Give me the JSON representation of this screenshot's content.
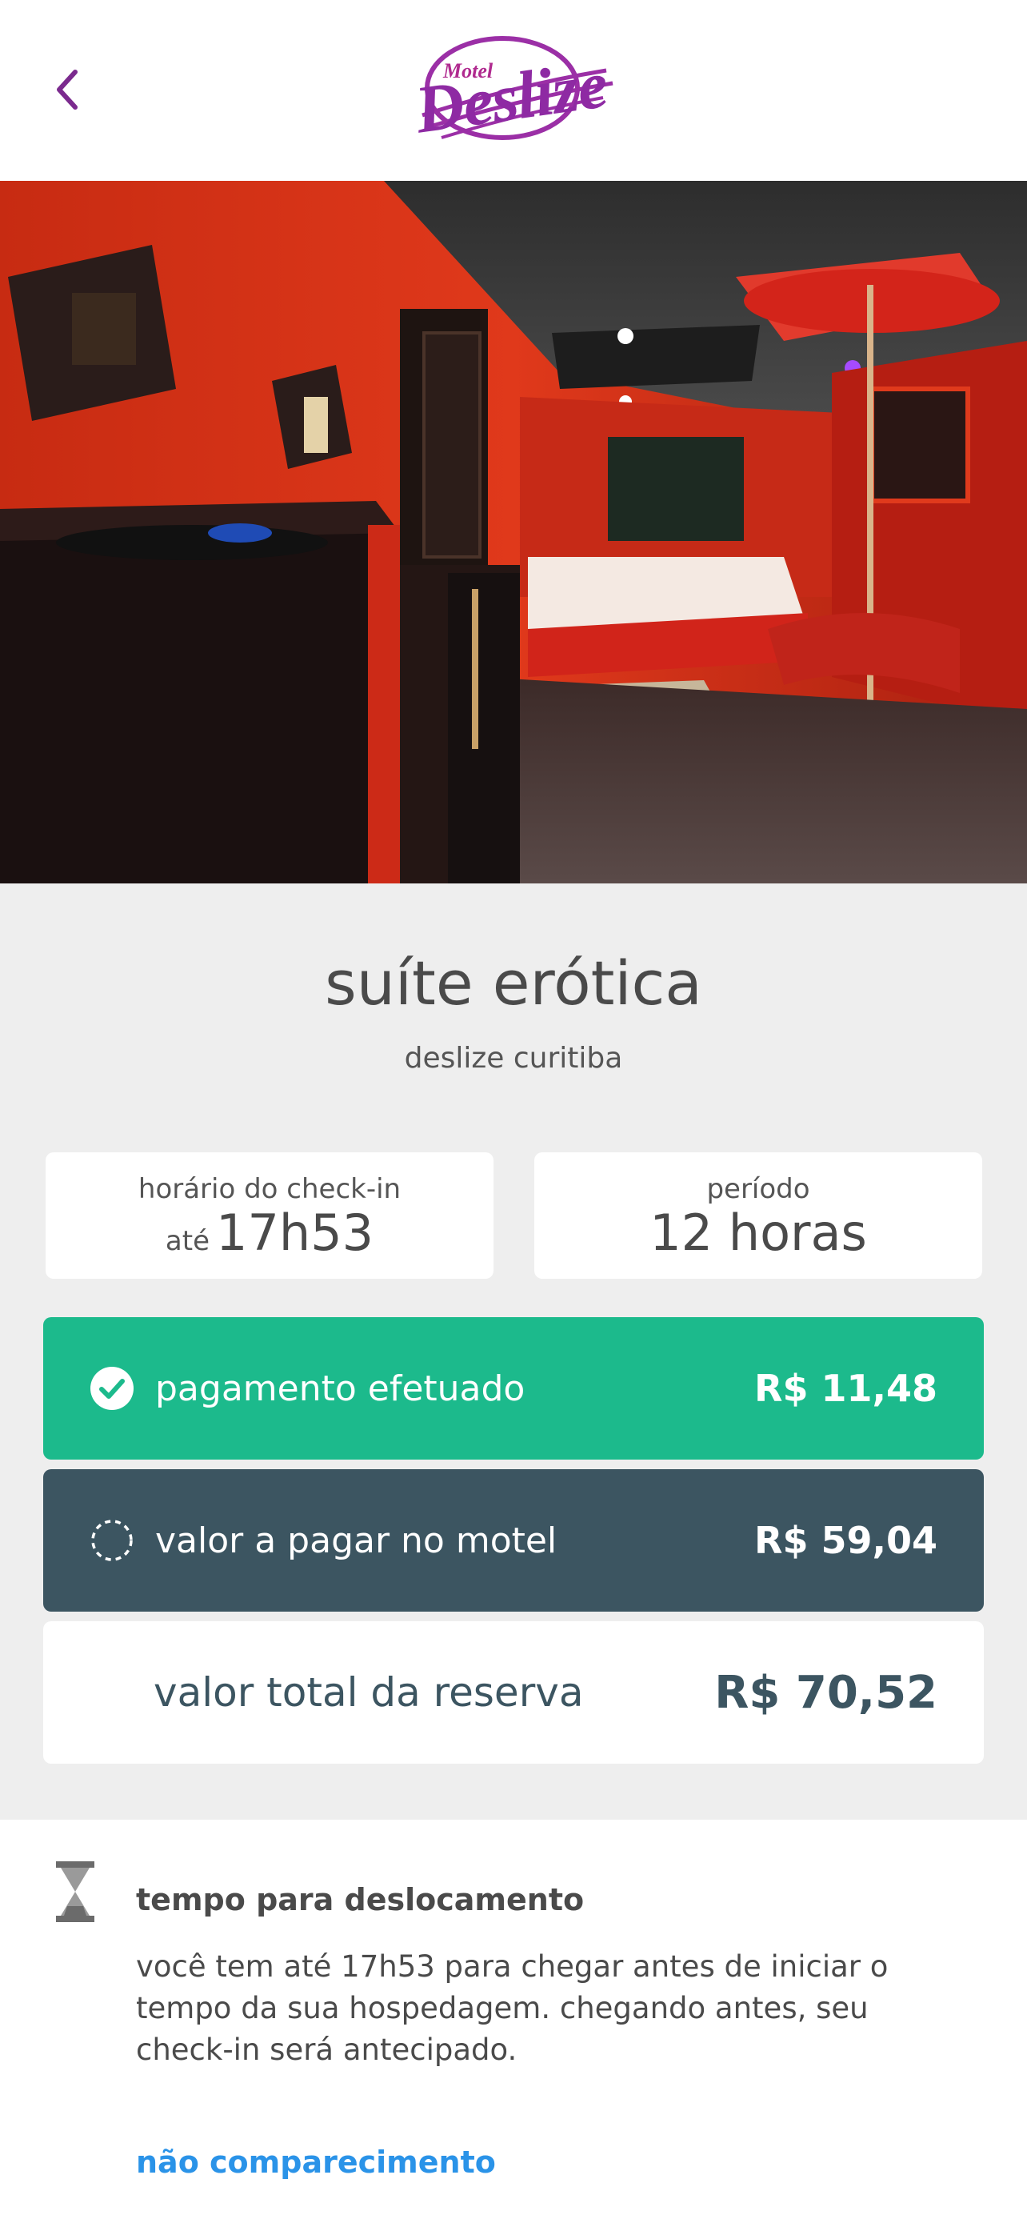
{
  "header": {
    "back_label": "",
    "logo_small_text": "Motel",
    "logo_big_text": "Deslize"
  },
  "hero": {
    "image_description": "suite interior photo"
  },
  "suite": {
    "title": "suíte erótica",
    "subtitle": "deslize curitiba"
  },
  "checkin": {
    "label": "horário do check-in",
    "prefix": "até",
    "value": "17h53"
  },
  "period": {
    "label": "período",
    "value": "12 horas"
  },
  "payments": {
    "paid_label": "pagamento efetuado",
    "paid_amount": "R$ 11,48",
    "due_label": "valor a pagar no motel",
    "due_amount": "R$ 59,04",
    "total_label": "valor total da reserva",
    "total_amount": "R$ 70,52"
  },
  "travel": {
    "title": "tempo para deslocamento",
    "text": "você tem até 17h53 para chegar antes de iniciar o tempo da sua hospedagem. chegando antes, seu check-in será antecipado.",
    "link": "não comparecimento"
  },
  "colors": {
    "accent_purple": "#8e2aa3",
    "paid_green": "#1cba8c",
    "due_slate": "#3c5561",
    "link_blue": "#2a93e8",
    "background_gray": "#eeeeee"
  }
}
